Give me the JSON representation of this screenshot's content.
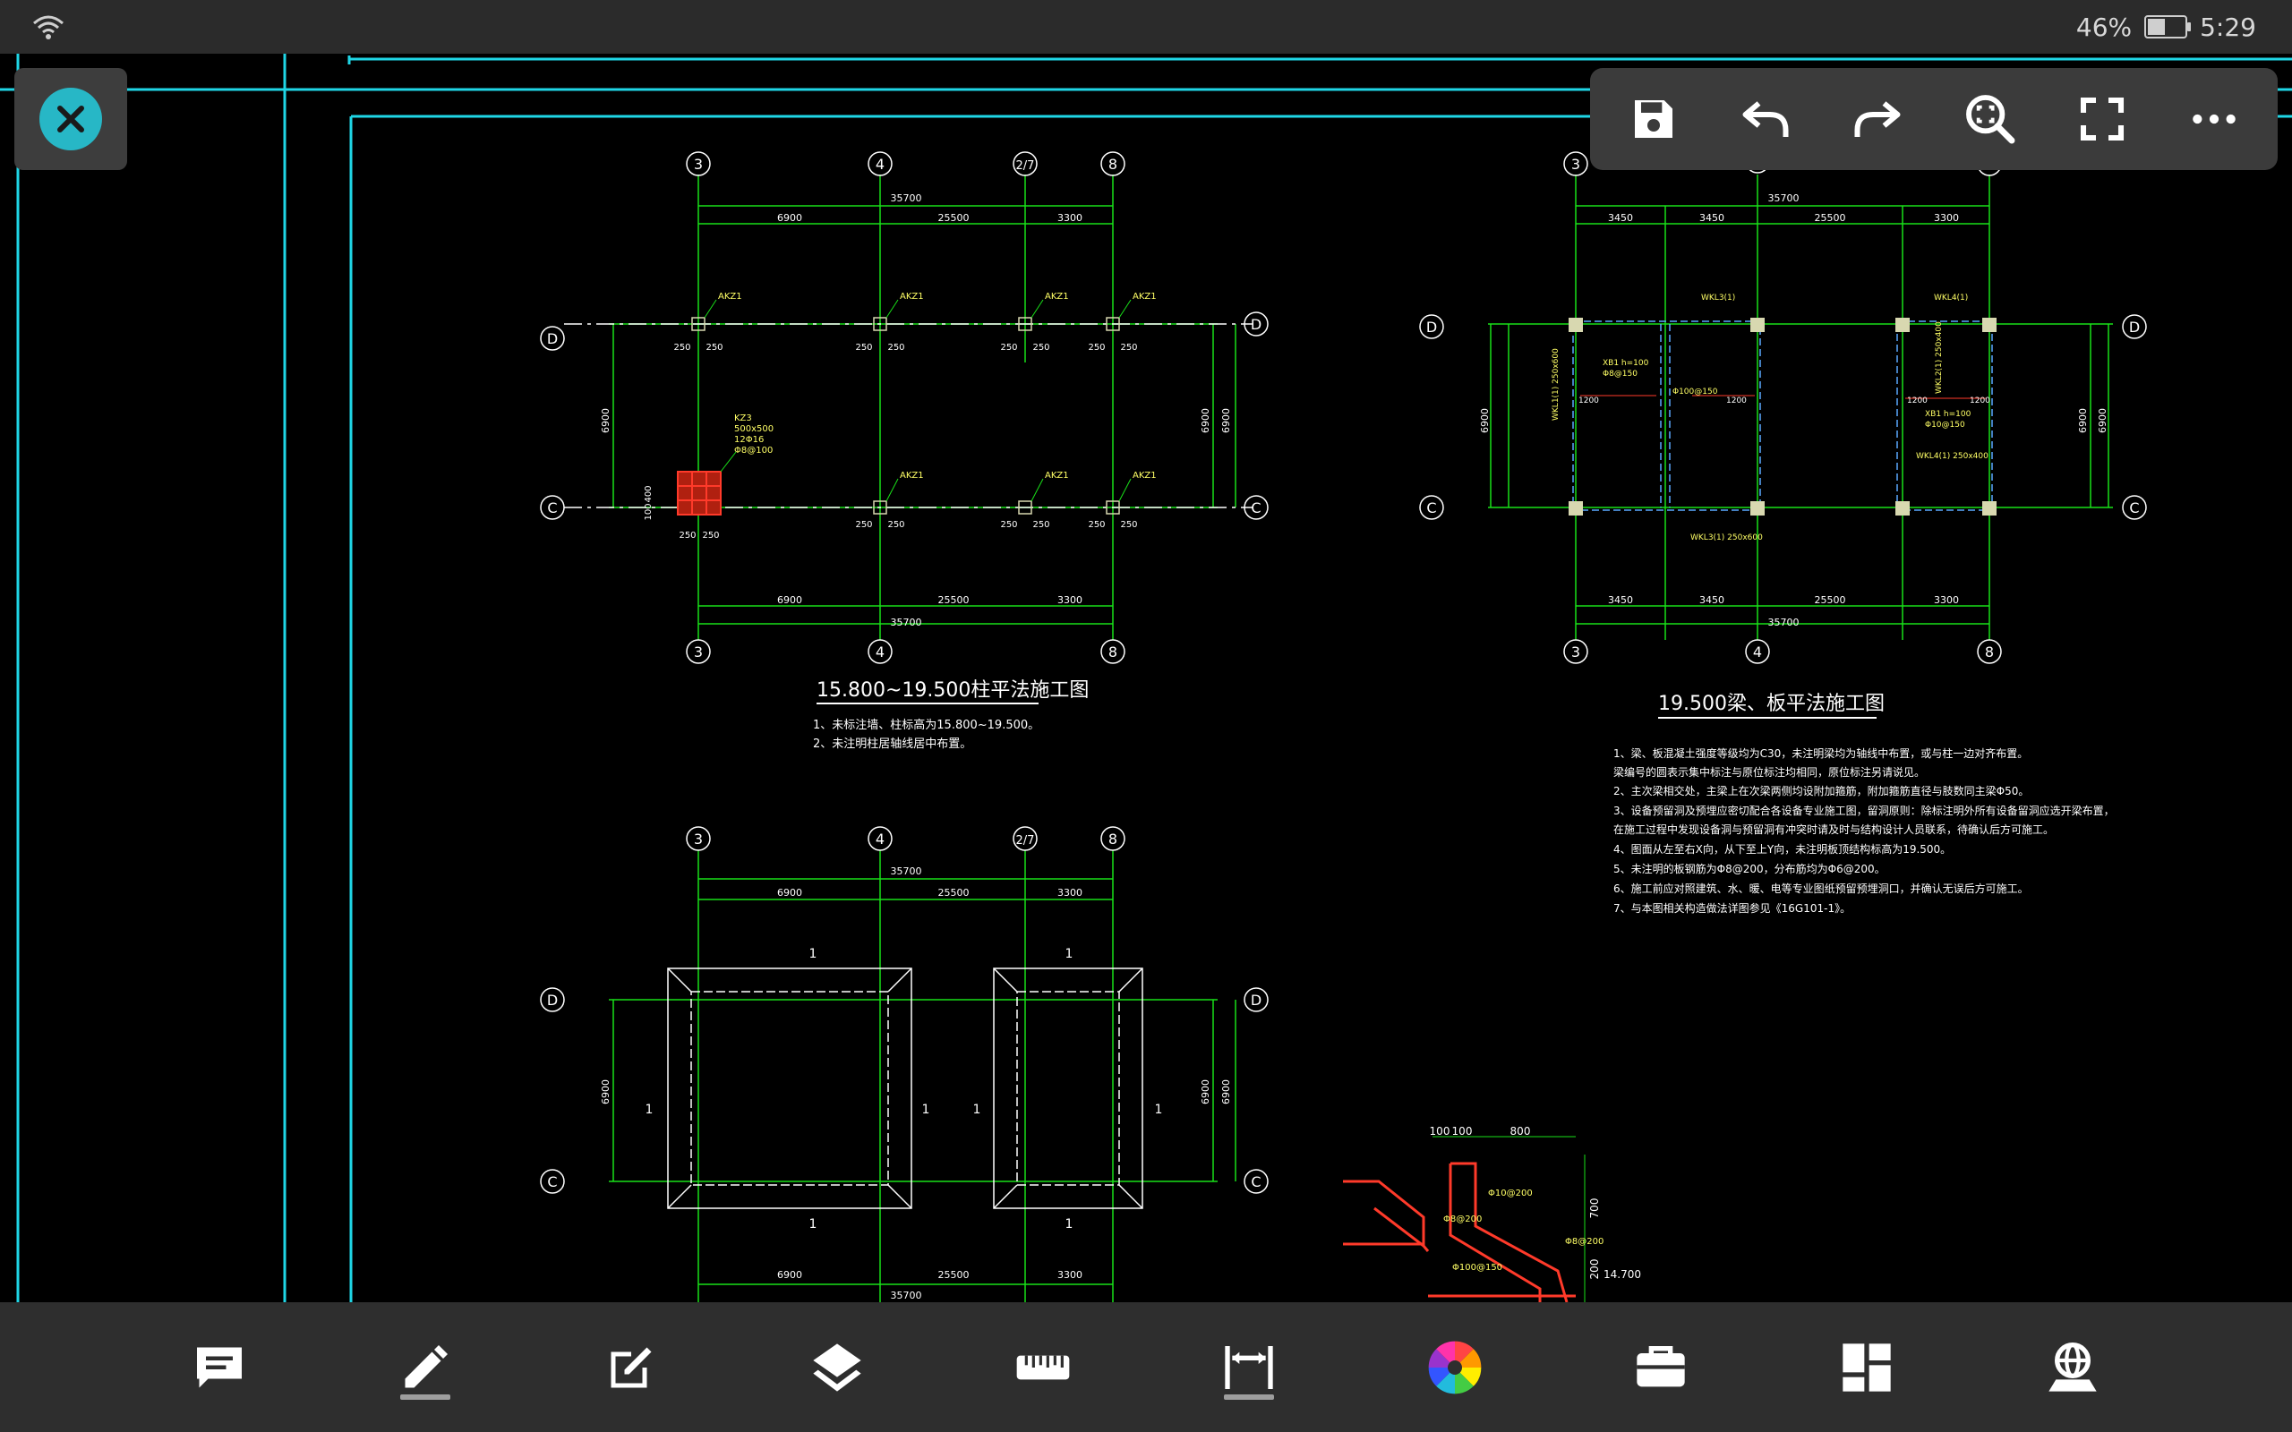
{
  "status_bar": {
    "battery_percent": "46%",
    "battery_level": 0.46,
    "time": "5:29",
    "wifi_icon": "wifi-icon"
  },
  "drawing": {
    "colors": {
      "frame": "#1fd6e6",
      "axis": "#19e019",
      "dim": "#19e019",
      "text": "#ffffff",
      "label": "#ffff66",
      "highlight": "#ff3a2a",
      "column": "#d8d8b0"
    },
    "view1": {
      "title": "15.800~19.500柱平法施工图",
      "notes": [
        "1、未标注墙、柱标高为15.800~19.500。",
        "2、未注明柱居轴线居中布置。"
      ],
      "axes_top": [
        "3",
        "4",
        "2/7",
        "8"
      ],
      "axes_bottom": [
        "3",
        "4",
        "8"
      ],
      "axes_side": [
        "D",
        "C"
      ],
      "dims_top": [
        "6900",
        "25500",
        "3300"
      ],
      "dim_total": "35700",
      "dim_side": "6900",
      "col_label": "AKZ1",
      "kz_label": [
        "KZ3",
        "500x500",
        "12Φ16",
        "Φ8@100"
      ],
      "dim_250": "250",
      "dim_100": "100",
      "dim_400": "400"
    },
    "view2": {
      "title": "19.500梁、板平法施工图",
      "notes": [
        "1、梁、板混凝土强度等级均为C30，未注明梁均为轴线中布置，或与柱一边对齐布置。",
        "梁编号的圆表示集中标注与原位标注均相同，原位标注另请说见。",
        "2、主次梁相交处，主梁上在次梁两侧均设附加箍筋，附加箍筋直径与肢数同主梁Φ50。",
        "3、设备预留洞及预埋应密切配合各设备专业施工图，留洞原则：除标注明外所有设备留洞应选开梁布置，",
        "在施工过程中发现设备洞与预留洞有冲突时请及时与结构设计人员联系，待确认后方可施工。",
        "4、图面从左至右X向，从下至上Y向，未注明板顶结构标高为19.500。",
        "5、未注明的板钢筋为Φ8@200，分布筋均为Φ6@200。",
        "6、施工前应对照建筑、水、暖、电等专业图纸预留预埋洞口，并确认无误后方可施工。",
        "7、与本图相关构造做法详图参见《16G101-1》。"
      ],
      "axes_top": [
        "3",
        "4",
        "8"
      ],
      "axes_side": [
        "D",
        "C"
      ],
      "dims_top": [
        "3450",
        "3450",
        "25500",
        "3300"
      ],
      "dim_total": "35700",
      "dim_side": "6900",
      "labels": [
        "WKL3(1)",
        "WKL4(1)",
        "WKL1(1) 250x600",
        "WKL2(1) 250x400",
        "WKL3(1) 250x600",
        "WKL4(1) 250x400",
        "XB1 h=100",
        "Φ8@150",
        "Φ10@150",
        "Φ100@150",
        "1200"
      ]
    },
    "view3": {
      "axes_top": [
        "3",
        "4",
        "2/7",
        "8"
      ],
      "axes_side": [
        "D",
        "C"
      ],
      "dims_top": [
        "6900",
        "25500",
        "3300"
      ],
      "dims_bottom": [
        "6900",
        "25500",
        "3300"
      ],
      "dim_total": "35700",
      "dim_side": "6900",
      "section_mark": "1"
    },
    "detail": {
      "dims": [
        "100",
        "100",
        "800",
        "700",
        "200",
        "14.700"
      ],
      "labels": [
        "Φ10@200",
        "Φ8@200",
        "Φ100@150",
        "Φ8@200"
      ]
    }
  },
  "top_toolbar": {
    "items": [
      {
        "name": "save-icon"
      },
      {
        "name": "undo-icon"
      },
      {
        "name": "redo-icon"
      },
      {
        "name": "zoom-extents-icon"
      },
      {
        "name": "fullscreen-icon"
      },
      {
        "name": "more-icon"
      }
    ]
  },
  "bottom_toolbar": {
    "items": [
      {
        "name": "comment-icon"
      },
      {
        "name": "pen-icon",
        "selected": true
      },
      {
        "name": "edit-icon"
      },
      {
        "name": "layers-icon"
      },
      {
        "name": "ruler-icon"
      },
      {
        "name": "dimension-icon",
        "selected": true
      },
      {
        "name": "color-wheel-icon"
      },
      {
        "name": "toolbox-icon"
      },
      {
        "name": "layout-icon"
      },
      {
        "name": "3d-view-icon"
      }
    ]
  }
}
